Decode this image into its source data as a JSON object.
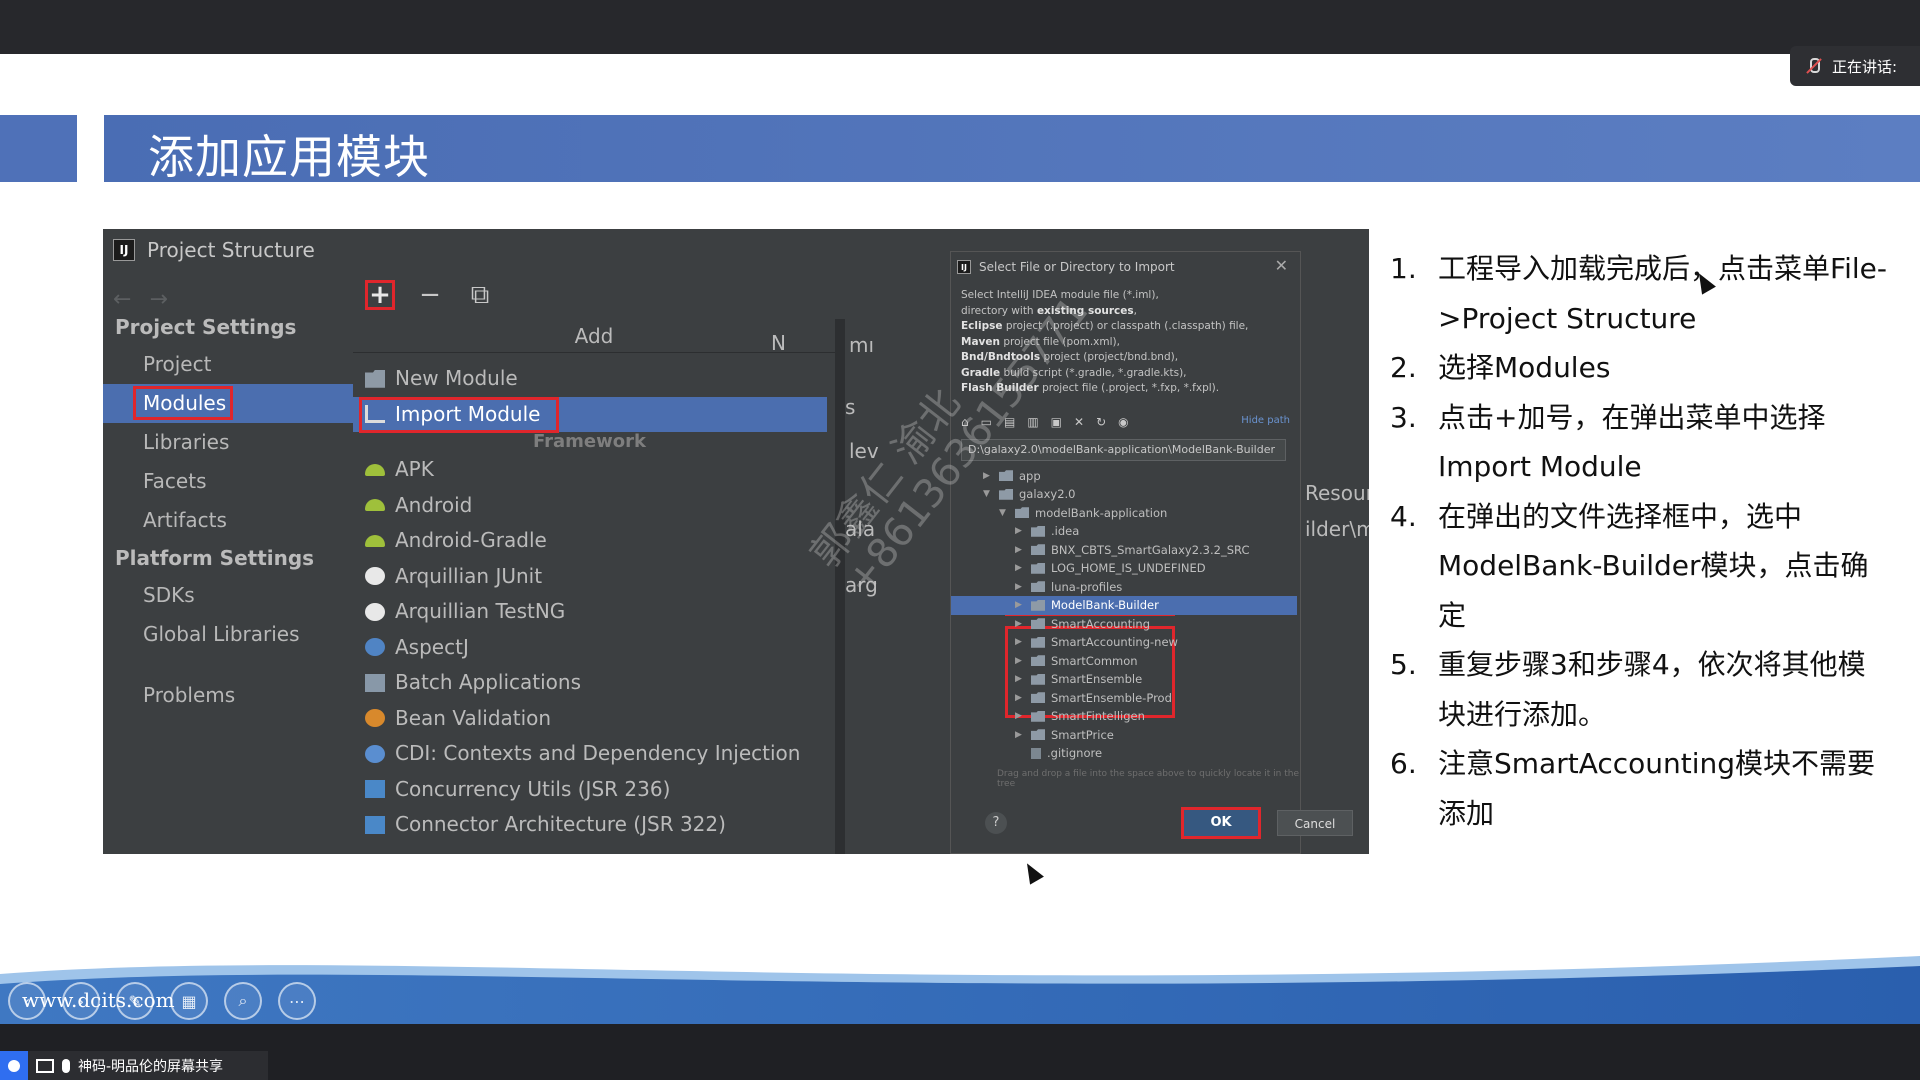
{
  "meeting": {
    "speaking_label": "正在讲话:",
    "share_label": "神码-明品伦的屏幕共享"
  },
  "slide": {
    "title": "添加应用模块",
    "website": "www.dcits.com",
    "steps": [
      {
        "num": "1.",
        "text": "工程导入加载完成后，点击菜单File->Project Structure"
      },
      {
        "num": "2.",
        "text": "选择Modules"
      },
      {
        "num": "3.",
        "text": "点击+加号，在弹出菜单中选择Import Module"
      },
      {
        "num": "4.",
        "text": "在弹出的文件选择框中，选中ModelBank-Builder模块，点击确定"
      },
      {
        "num": "5.",
        "text": "重复步骤3和步骤4，依次将其他模块进行添加。"
      },
      {
        "num": "6.",
        "text": "注意SmartAccounting模块不需要添加"
      }
    ],
    "watermark": "郭鑫仁 渝北\n+8613636155771"
  },
  "project_structure": {
    "window_title": "Project Structure",
    "logo_text": "IJ",
    "project_settings_header": "Project Settings",
    "platform_settings_header": "Platform Settings",
    "items": {
      "project": "Project",
      "modules": "Modules",
      "libraries": "Libraries",
      "facets": "Facets",
      "artifacts": "Artifacts",
      "sdks": "SDKs",
      "global_libraries": "Global Libraries",
      "problems": "Problems"
    },
    "toolbar": {
      "add": "+",
      "remove": "−",
      "copy": "⧉"
    },
    "add_menu": {
      "header": "Add",
      "new_module": "New Module",
      "import_module": "Import Module",
      "framework_label": "Framework",
      "frameworks": [
        {
          "label": "APK",
          "icon": "android-icon"
        },
        {
          "label": "Android",
          "icon": "android-icon"
        },
        {
          "label": "Android-Gradle",
          "icon": "android-icon"
        },
        {
          "label": "Arquillian JUnit",
          "icon": "arquillian-icon"
        },
        {
          "label": "Arquillian TestNG",
          "icon": "arquillian-icon"
        },
        {
          "label": "AspectJ",
          "icon": "aspectj-icon"
        },
        {
          "label": "Batch Applications",
          "icon": "batch-icon"
        },
        {
          "label": "Bean Validation",
          "icon": "bean-validation-icon"
        },
        {
          "label": "CDI: Contexts and Dependency Injection",
          "icon": "cdi-icon"
        },
        {
          "label": "Concurrency Utils (JSR 236)",
          "icon": "jsr-icon"
        },
        {
          "label": "Connector Architecture (JSR 322)",
          "icon": "jsr-icon"
        }
      ]
    },
    "background_fragments": {
      "n": "N",
      "m": "mı",
      "s": "s",
      "lev": "lev",
      "ala": "ala",
      "arg": "arg",
      "resour": "Resour",
      "ilder": "ilder\\m"
    }
  },
  "file_dialog": {
    "title": "Select File or Directory to Import",
    "desc_line1": "Select IntelliJ IDEA module file (*.iml),",
    "desc_line2_a": "directory with ",
    "desc_line2_b": "existing sources",
    "desc_line2_c": ",",
    "eclipse_b": "Eclipse",
    "eclipse_t": " project (.project) or classpath (.classpath) file,",
    "maven_b": "Maven",
    "maven_t": " project file (pom.xml),",
    "bnd_b": "Bnd/Bndtools",
    "bnd_t": " project (project/bnd.bnd),",
    "gradle_b": "Gradle",
    "gradle_t": " build script (*.gradle, *.gradle.kts),",
    "flash_b": "Flash Builder",
    "flash_t": " project file (.project, *.fxp, *.fxpl).",
    "hide_path": "Hide path",
    "path": "D:\\galaxy2.0\\modelBank-application\\ModelBank-Builder",
    "tree": [
      {
        "label": "app",
        "level": 1,
        "arrow": "▶"
      },
      {
        "label": "galaxy2.0",
        "level": 1,
        "arrow": "▼"
      },
      {
        "label": "modelBank-application",
        "level": 2,
        "arrow": "▼"
      },
      {
        "label": ".idea",
        "level": 3,
        "arrow": "▶"
      },
      {
        "label": "BNX_CBTS_SmartGalaxy2.3.2_SRC",
        "level": 3,
        "arrow": "▶"
      },
      {
        "label": "LOG_HOME_IS_UNDEFINED",
        "level": 3,
        "arrow": "▶"
      },
      {
        "label": "luna-profiles",
        "level": 3,
        "arrow": "▶"
      },
      {
        "label": "ModelBank-Builder",
        "level": 3,
        "arrow": "▶"
      },
      {
        "label": "SmartAccounting",
        "level": 3,
        "arrow": "▶"
      },
      {
        "label": "SmartAccounting-new",
        "level": 3,
        "arrow": "▶"
      },
      {
        "label": "SmartCommon",
        "level": 3,
        "arrow": "▶"
      },
      {
        "label": "SmartEnsemble",
        "level": 3,
        "arrow": "▶"
      },
      {
        "label": "SmartEnsemble-Prod",
        "level": 3,
        "arrow": "▶"
      },
      {
        "label": "SmartFintelligen",
        "level": 3,
        "arrow": "▶"
      },
      {
        "label": "SmartPrice",
        "level": 3,
        "arrow": "▶"
      },
      {
        "label": ".gitignore",
        "level": 3,
        "arrow": ""
      }
    ],
    "hint": "Drag and drop a file into the space above to quickly locate it in the tree",
    "help": "?",
    "ok": "OK",
    "cancel": "Cancel"
  }
}
